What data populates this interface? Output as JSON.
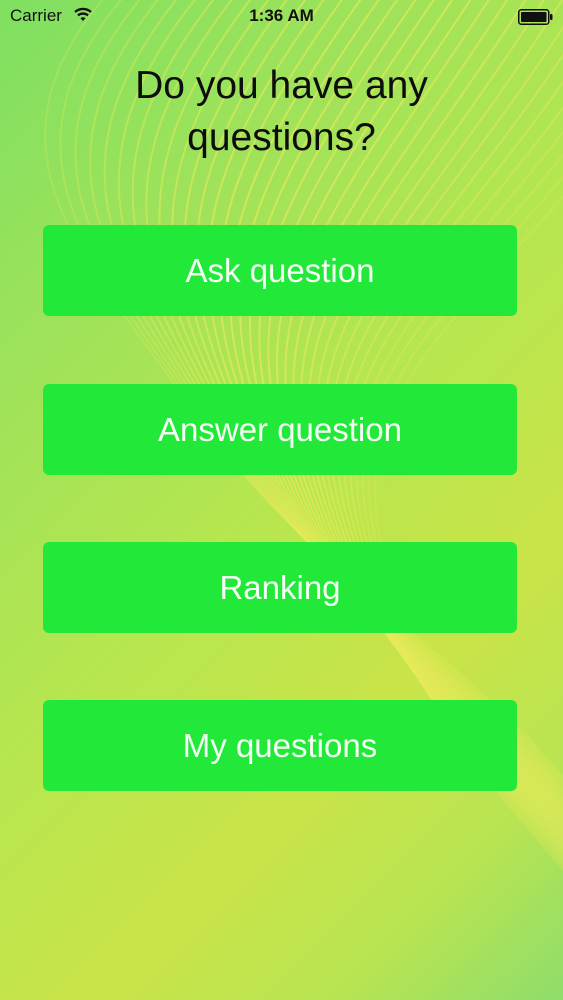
{
  "status_bar": {
    "carrier": "Carrier",
    "time": "1:36 AM",
    "wifi_icon": "wifi-icon",
    "battery_icon": "battery-icon"
  },
  "main": {
    "title": "Do you have any questions?",
    "buttons": [
      {
        "id": "ask",
        "label": "Ask question"
      },
      {
        "id": "answer",
        "label": "Answer question"
      },
      {
        "id": "ranking",
        "label": "Ranking"
      },
      {
        "id": "my_questions",
        "label": "My questions"
      }
    ]
  },
  "colors": {
    "button_green": "#22e83a",
    "button_text": "#f4fff4",
    "background_green": "#8fdd6a",
    "background_yellow": "#c9e448"
  }
}
